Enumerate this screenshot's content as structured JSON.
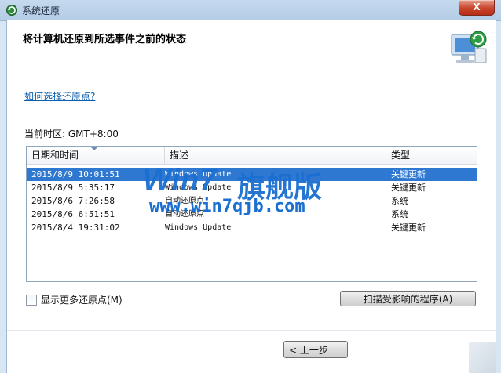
{
  "window": {
    "title": "系统还原",
    "close_label": "X"
  },
  "header": {
    "title": "将计算机还原到所选事件之前的状态"
  },
  "help_link": "如何选择还原点?",
  "timezone": "当前时区: GMT+8:00",
  "list": {
    "columns": [
      "日期和时间",
      "描述",
      "类型"
    ],
    "rows": [
      {
        "date": "2015/8/9 10:01:51",
        "desc": "Windows Update",
        "type": "关键更新",
        "selected": true
      },
      {
        "date": "2015/8/9 5:35:17",
        "desc": "Windows Update",
        "type": "关键更新",
        "selected": false
      },
      {
        "date": "2015/8/6 7:26:58",
        "desc": "自动还原点",
        "type": "系统",
        "selected": false
      },
      {
        "date": "2015/8/6 6:51:51",
        "desc": "自动还原点",
        "type": "系统",
        "selected": false
      },
      {
        "date": "2015/8/4 19:31:02",
        "desc": "Windows Update",
        "type": "关键更新",
        "selected": false
      }
    ]
  },
  "watermark": {
    "logo": "Win7",
    "name": "旗舰版",
    "url": "www.win7qjb.com"
  },
  "show_more_label": "显示更多还原点(M)",
  "scan_button_label": "扫描受影响的程序(A)",
  "back_button_label": "< 上一步",
  "colors": {
    "selection": "#2f78d2",
    "link": "#0b5fb0",
    "watermark": "#1a6fd1"
  }
}
